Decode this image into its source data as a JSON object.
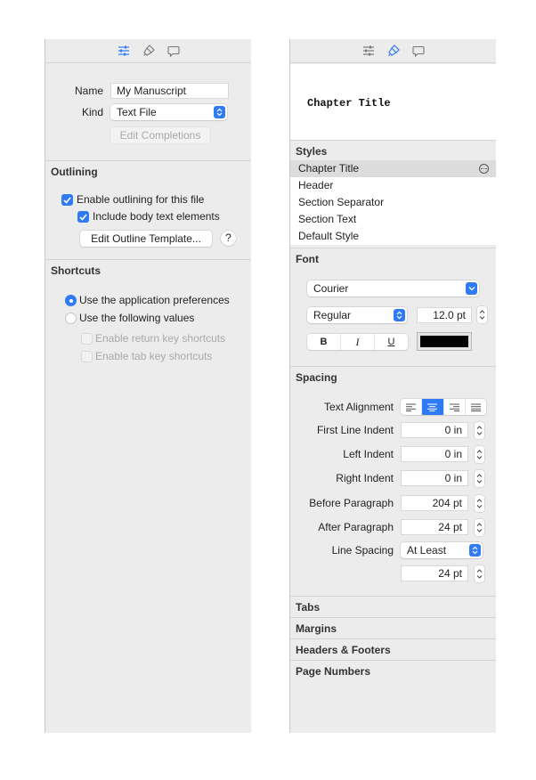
{
  "left_panel": {
    "toolbar": {
      "icons": [
        "sliders-icon",
        "paintbrush-icon",
        "comment-icon"
      ],
      "active": "sliders-icon"
    },
    "name_label": "Name",
    "name_value": "My Manuscript",
    "kind_label": "Kind",
    "kind_value": "Text File",
    "edit_completions": "Edit Completions",
    "outlining": {
      "title": "Outlining",
      "enable_outlining": {
        "label": "Enable outlining for this file",
        "checked": true
      },
      "include_body": {
        "label": "Include body text elements",
        "checked": true
      },
      "edit_template": "Edit Outline Template...",
      "help": "?"
    },
    "shortcuts": {
      "title": "Shortcuts",
      "use_app_prefs": {
        "label": "Use the application preferences",
        "selected": true
      },
      "use_following": {
        "label": "Use the following values",
        "selected": false
      },
      "return_key": {
        "label": "Enable return key shortcuts",
        "checked": false,
        "enabled": false
      },
      "tab_key": {
        "label": "Enable tab key shortcuts",
        "checked": false,
        "enabled": false
      }
    }
  },
  "right_panel": {
    "toolbar": {
      "icons": [
        "sliders-icon",
        "paintbrush-icon",
        "comment-icon"
      ],
      "active": "paintbrush-icon"
    },
    "preview_text": "Chapter Title",
    "styles": {
      "title": "Styles",
      "items": [
        {
          "label": "Chapter Title",
          "selected": true
        },
        {
          "label": "Header",
          "selected": false
        },
        {
          "label": "Section Separator",
          "selected": false
        },
        {
          "label": "Section Text",
          "selected": false
        },
        {
          "label": "Default Style",
          "selected": false
        }
      ]
    },
    "font": {
      "title": "Font",
      "family": "Courier",
      "weight": "Regular",
      "size": "12.0 pt",
      "bold": "B",
      "italic": "I",
      "underline": "U",
      "color": "#000000"
    },
    "spacing": {
      "title": "Spacing",
      "text_alignment_label": "Text Alignment",
      "alignment_options": [
        "left",
        "center",
        "right",
        "justify"
      ],
      "alignment_selected": "center",
      "first_line_indent": {
        "label": "First Line Indent",
        "value": "0 in"
      },
      "left_indent": {
        "label": "Left Indent",
        "value": "0 in"
      },
      "right_indent": {
        "label": "Right Indent",
        "value": "0 in"
      },
      "before_paragraph": {
        "label": "Before Paragraph",
        "value": "204 pt"
      },
      "after_paragraph": {
        "label": "After Paragraph",
        "value": "24 pt"
      },
      "line_spacing": {
        "label": "Line Spacing",
        "value": "At Least"
      },
      "line_spacing_amount": "24 pt"
    },
    "collapsed_sections": [
      "Tabs",
      "Margins",
      "Headers & Footers",
      "Page Numbers"
    ]
  },
  "colors": {
    "accent": "#2f7bf5",
    "panel_bg": "#ececec",
    "selected_row": "#dcdcdc"
  }
}
